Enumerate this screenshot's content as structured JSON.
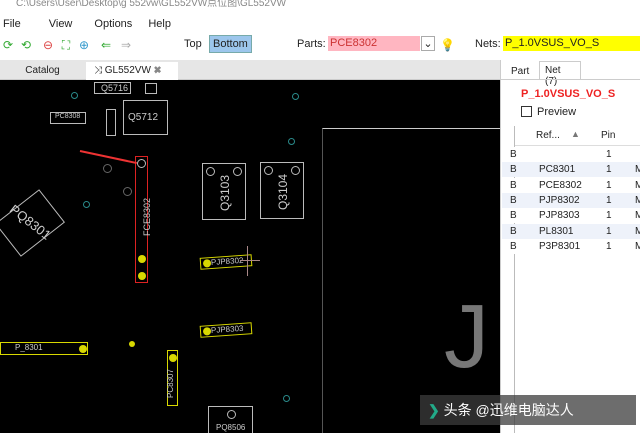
{
  "window": {
    "title": "C:\\Users\\User\\Desktop\\g 552vw\\GL552VW点位图\\GL552VW"
  },
  "menu": [
    "File",
    "View",
    "Options",
    "Help"
  ],
  "toolbar": {
    "top_label": "Top",
    "bottom_label": "Bottom",
    "parts_label": "Parts:",
    "parts_value": "PCE8302",
    "nets_label": "Nets:",
    "nets_value": "P_1.0VSUS_VO_S",
    "parts_bg": "#ffb6c1",
    "nets_bg": "#ffff00"
  },
  "tabs": [
    {
      "label": "Catalog"
    },
    {
      "label": "GL552VW"
    }
  ],
  "board": {
    "parts": [
      "Q5716",
      "PC8308",
      "Q5712",
      "PQ8301",
      "FCE8302",
      "Q3103",
      "Q3104",
      "PJP8302",
      "P_8301",
      "PJP8303",
      "PC8307",
      "PQ8506"
    ],
    "big_letter": "J"
  },
  "panel": {
    "tabs": [
      "Part",
      "Net (7)"
    ],
    "net_name": "P_1.0VSUS_VO_S",
    "preview_label": "Preview",
    "columns": [
      "Ref...",
      "Pin"
    ],
    "rows": [
      {
        "side": "B",
        "ref": "",
        "pin": "1",
        "extra": ""
      },
      {
        "side": "B",
        "ref": "PC8301",
        "pin": "1",
        "extra": "M"
      },
      {
        "side": "B",
        "ref": "PCE8302",
        "pin": "1",
        "extra": "M"
      },
      {
        "side": "B",
        "ref": "PJP8302",
        "pin": "1",
        "extra": "M"
      },
      {
        "side": "B",
        "ref": "PJP8303",
        "pin": "1",
        "extra": "M"
      },
      {
        "side": "B",
        "ref": "PL8301",
        "pin": "1",
        "extra": "M"
      },
      {
        "side": "B",
        "ref": "P3P8301",
        "pin": "1",
        "extra": "M"
      }
    ]
  },
  "watermark": "头条 @迅维电脑达人"
}
